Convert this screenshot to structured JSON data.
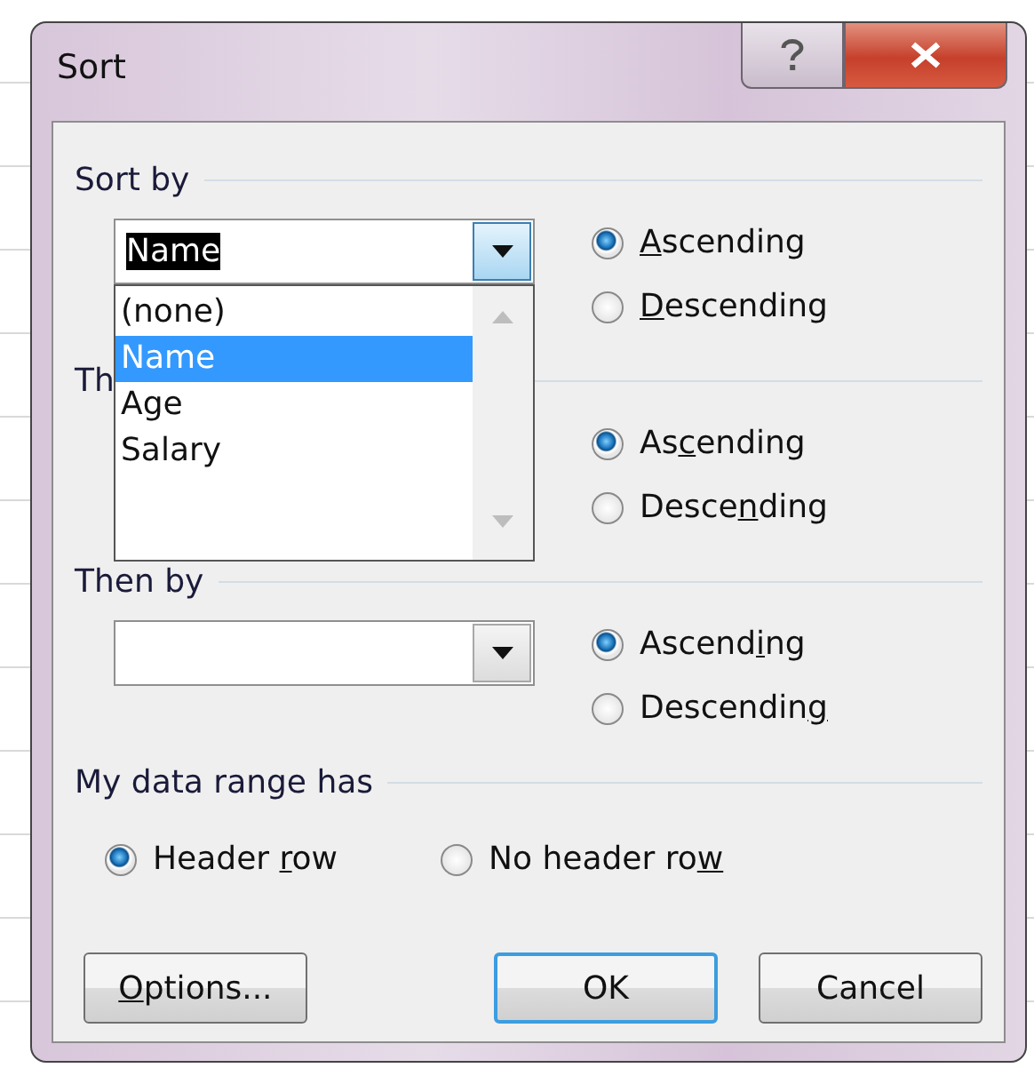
{
  "window": {
    "title": "Sort"
  },
  "levels": [
    {
      "label": "Sort by",
      "field": {
        "kind": "combo",
        "value": "Name",
        "highlighted": true,
        "button_pressed": true
      },
      "dropdown": {
        "options": [
          {
            "label": "(none)",
            "selected": false
          },
          {
            "label": "Name",
            "selected": true
          },
          {
            "label": "Age",
            "selected": false
          },
          {
            "label": "Salary",
            "selected": false
          }
        ]
      },
      "orders": [
        {
          "key": "A",
          "post": "scending",
          "selected": true
        },
        {
          "key": "D",
          "post": "escending",
          "selected": false
        }
      ]
    },
    {
      "label": "Th",
      "orders": [
        {
          "pre": "As",
          "key": "c",
          "post": "ending",
          "selected": true
        },
        {
          "pre": "Desce",
          "key": "n",
          "post": "ding",
          "selected": false
        }
      ]
    },
    {
      "label": "Then by",
      "field": {
        "kind": "combo",
        "button_pressed": false
      },
      "orders": [
        {
          "pre": "Ascend",
          "key": "i",
          "post": "ng",
          "selected": true
        },
        {
          "pre": "Descendin",
          "key": "g",
          "selected": false
        }
      ]
    }
  ],
  "header": {
    "label": "My data range has",
    "options": [
      {
        "pre": "Header ",
        "key": "r",
        "post": "ow",
        "selected": true
      },
      {
        "pre": "No header ro",
        "key": "w",
        "selected": false
      }
    ]
  },
  "buttons": [
    {
      "key": "O",
      "post": "ptions...",
      "default": false,
      "kind": "left"
    },
    {
      "pre": "OK",
      "default": true,
      "kind": "right"
    },
    {
      "pre": "Cancel",
      "default": false,
      "kind": "right"
    }
  ]
}
